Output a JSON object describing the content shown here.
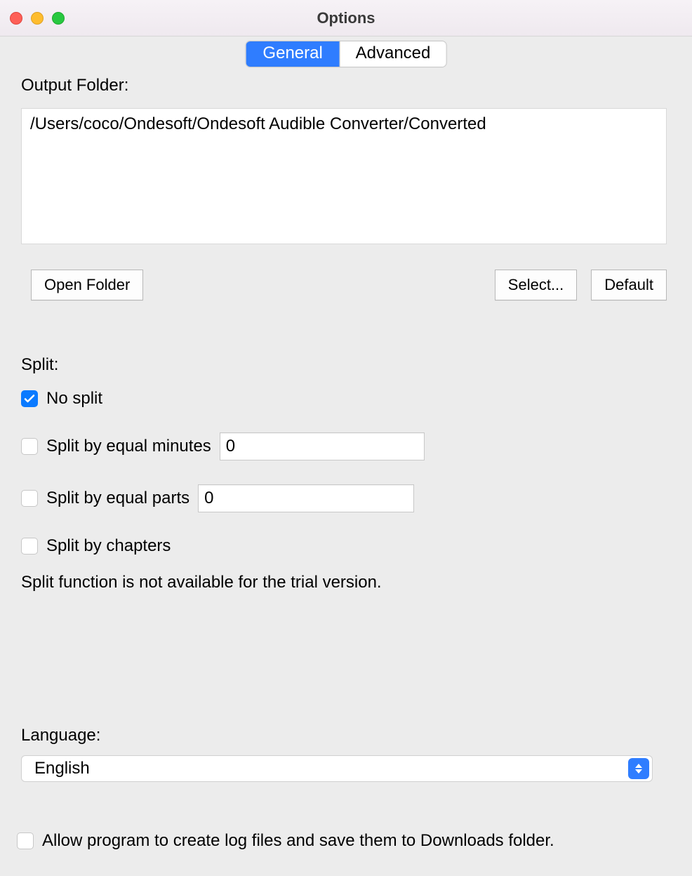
{
  "window_title": "Options",
  "tabs": {
    "general": "General",
    "advanced": "Advanced"
  },
  "output_folder": {
    "label": "Output Folder:",
    "value": "/Users/coco/Ondesoft/Ondesoft Audible Converter/Converted"
  },
  "buttons": {
    "open_folder": "Open Folder",
    "select": "Select...",
    "default": "Default"
  },
  "split": {
    "label": "Split:",
    "no_split": "No split",
    "by_minutes": "Split by equal minutes",
    "by_minutes_value": "0",
    "by_parts": "Split by equal parts",
    "by_parts_value": "0",
    "by_chapters": "Split by chapters",
    "trial_note": "Split function is not available for the trial version."
  },
  "language": {
    "label": "Language:",
    "value": "English"
  },
  "log_checkbox": "Allow program to create log files and save them to Downloads folder."
}
